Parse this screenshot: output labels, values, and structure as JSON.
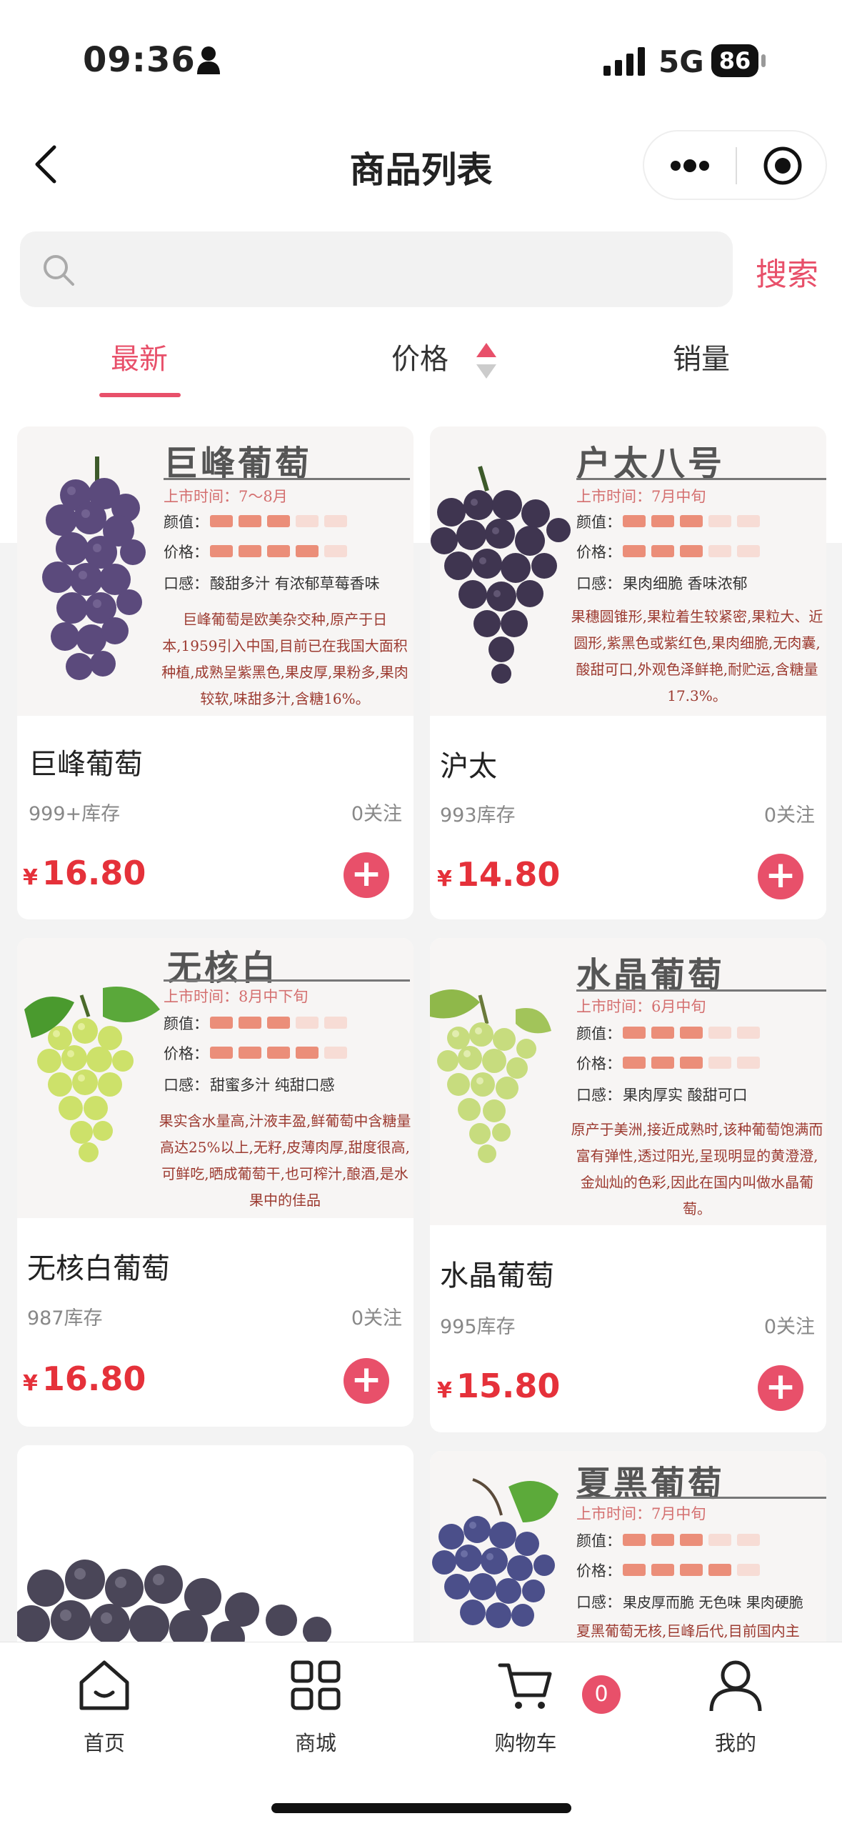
{
  "status": {
    "time": "09:36",
    "network": "5G",
    "battery": "86"
  },
  "nav": {
    "title": "商品列表"
  },
  "search": {
    "placeholder": "",
    "button": "搜索"
  },
  "tabs": [
    {
      "label": "最新",
      "active": true
    },
    {
      "label": "价格"
    },
    {
      "label": "销量"
    }
  ],
  "colors": {
    "accent": "#e8506a",
    "price": "#e5313a"
  },
  "products": [
    {
      "img_title": "巨峰葡萄",
      "img_date": "上市时间：7～8月",
      "look_label": "颜值：",
      "look_level": 3,
      "price_label": "价格：",
      "price_level": 4,
      "taste_label": "口感：",
      "taste": "酸甜多汁 有浓郁草莓香味",
      "desc": "巨峰葡萄是欧美杂交种,原产于日本,1959引入中国,目前已在我国大面积种植,成熟呈紫黑色,果皮厚,果粉多,果肉较软,味甜多汁,含糖16%。",
      "name": "巨峰葡萄",
      "stock": "999+库存",
      "follow": "0关注",
      "currency": "¥",
      "price": "16.80"
    },
    {
      "img_title": "户太八号",
      "img_date": "上市时间：7月中旬",
      "look_label": "颜值：",
      "look_level": 3,
      "price_label": "价格：",
      "price_level": 3,
      "taste_label": "口感：",
      "taste": "果肉细脆 香味浓郁",
      "desc": "果穗圆锥形,果粒着生较紧密,果粒大、近圆形,紫黑色或紫红色,果肉细脆,无肉囊,酸甜可口,外观色泽鲜艳,耐贮运,含糖量17.3%。",
      "name": "沪太",
      "stock": "993库存",
      "follow": "0关注",
      "currency": "¥",
      "price": "14.80"
    },
    {
      "img_title": "无核白",
      "img_date": "上市时间：8月中下旬",
      "look_label": "颜值：",
      "look_level": 3,
      "price_label": "价格：",
      "price_level": 4,
      "taste_label": "口感：",
      "taste": "甜蜜多汁 纯甜口感",
      "desc": "果实含水量高,汁液丰盈,鲜葡萄中含糖量高达25%以上,无籽,皮薄肉厚,甜度很高,可鲜吃,晒成葡萄干,也可榨汁,酿酒,是水果中的佳品",
      "name": "无核白葡萄",
      "stock": "987库存",
      "follow": "0关注",
      "currency": "¥",
      "price": "16.80"
    },
    {
      "img_title": "水晶葡萄",
      "img_date": "上市时间：6月中旬",
      "look_label": "颜值：",
      "look_level": 3,
      "price_label": "价格：",
      "price_level": 3,
      "taste_label": "口感：",
      "taste": "果肉厚实 酸甜可口",
      "desc": "原产于美洲,接近成熟时,该种葡萄饱满而富有弹性,透过阳光,呈现明显的黄澄澄,金灿灿的色彩,因此在国内叫做水晶葡萄。",
      "name": "水晶葡萄",
      "stock": "995库存",
      "follow": "0关注",
      "currency": "¥",
      "price": "15.80"
    },
    {
      "img_title": "",
      "name": ""
    },
    {
      "img_title": "夏黑葡萄",
      "img_date": "上市时间：7月中旬",
      "look_label": "颜值：",
      "look_level": 3,
      "price_label": "价格：",
      "price_level": 4,
      "taste_label": "口感：",
      "taste": "果皮厚而脆 无色味 果肉硬脆",
      "desc": "夏黑葡萄无核,巨峰后代,目前国内主",
      "name": ""
    }
  ],
  "bottom_nav": [
    {
      "label": "首页",
      "icon": "home-icon"
    },
    {
      "label": "商城",
      "icon": "grid-icon"
    },
    {
      "label": "购物车",
      "icon": "cart-icon",
      "badge": "0"
    },
    {
      "label": "我的",
      "icon": "user-icon"
    }
  ]
}
